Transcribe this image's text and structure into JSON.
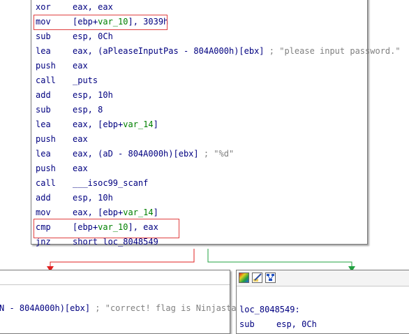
{
  "main_block": {
    "lines": [
      {
        "mn": "xor",
        "op": "eax, eax"
      },
      {
        "mn": "mov",
        "op_a": "[ebp+",
        "op_var": "var_10",
        "op_b": "], 3039h"
      },
      {
        "mn": "sub",
        "op": "esp, 0Ch"
      },
      {
        "mn": "lea",
        "op_a": "eax, (aPleaseInputPas - 804A000h)[ebx] ",
        "op_cmt": "; \"please input password.\""
      },
      {
        "mn": "push",
        "op": "eax"
      },
      {
        "mn": "call",
        "op": "_puts"
      },
      {
        "mn": "add",
        "op": "esp, 10h"
      },
      {
        "mn": "sub",
        "op": "esp, 8"
      },
      {
        "mn": "lea",
        "op_a": "eax, [ebp+",
        "op_var": "var_14",
        "op_b": "]"
      },
      {
        "mn": "push",
        "op": "eax"
      },
      {
        "mn": "lea",
        "op_a": "eax, (aD - 804A000h)[ebx] ",
        "op_cmt": "; \"%d\""
      },
      {
        "mn": "push",
        "op": "eax"
      },
      {
        "mn": "call",
        "op": "___isoc99_scanf"
      },
      {
        "mn": "add",
        "op": "esp, 10h"
      },
      {
        "mn": "mov",
        "op_a": "eax, [ebp+",
        "op_var": "var_14",
        "op_b": "]"
      },
      {
        "mn": "cmp",
        "op_a": "[ebp+",
        "op_var": "var_10",
        "op_b": "], eax"
      },
      {
        "mn": "jnz",
        "op": "short loc_8048549"
      }
    ]
  },
  "left_block": {
    "line_a": "N - 804A000h)[ebx] ",
    "line_cmt": "; \"correct! flag is Ninjastars\""
  },
  "right_block": {
    "label": "loc_8048549:",
    "next_mn": "sub",
    "next_op": "esp, 0Ch"
  },
  "colors": {
    "false_edge": "#e02020",
    "true_edge": "#20a040",
    "highlight": "#e04040",
    "mnemonic": "#000080",
    "variable": "#008000"
  }
}
